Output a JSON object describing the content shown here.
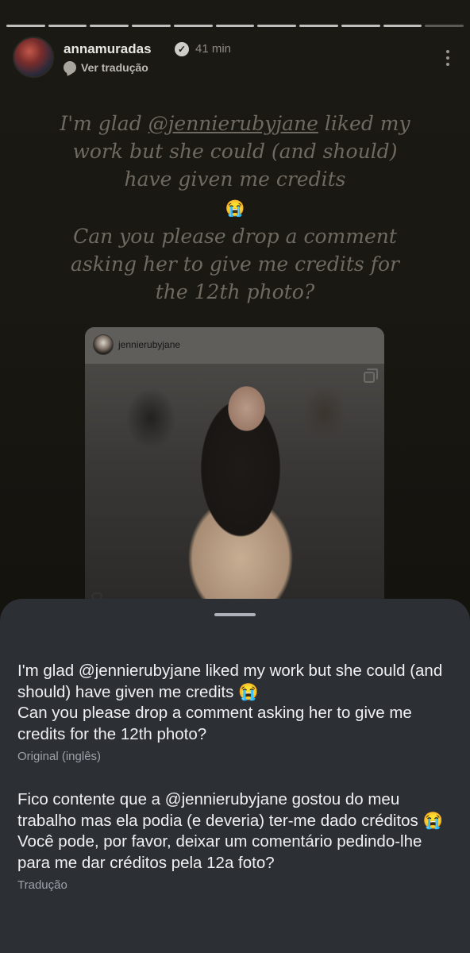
{
  "story": {
    "progress_total": 11,
    "progress_done": 10,
    "username": "annamuradas",
    "verified_icon": "verified-badge-icon",
    "time": "41 min",
    "translate_label": "Ver tradução",
    "text": {
      "line1_pre": "I'm glad ",
      "mention": "@jennierubyjane",
      "line1_post": " liked my work but she could (and should) have given me credits",
      "emoji": "😭",
      "line2": "Can you please drop a comment asking her to give me credits for the 12th photo?"
    }
  },
  "shared_post": {
    "username": "jennierubyjane"
  },
  "translation_sheet": {
    "original": "I'm glad @jennierubyjane liked my work but she could (and should) have given me credits 😭\nCan you please drop a comment asking her to give me credits for the 12th photo?",
    "original_caption": "Original (inglês)",
    "translated": "Fico contente que a @jennierubyjane gostou do meu trabalho mas ela podia (e deveria) ter-me dado créditos 😭\nVocê pode, por favor, deixar um comentário pedindo-lhe para me dar créditos pela 12a foto?",
    "translated_caption": "Tradução"
  }
}
